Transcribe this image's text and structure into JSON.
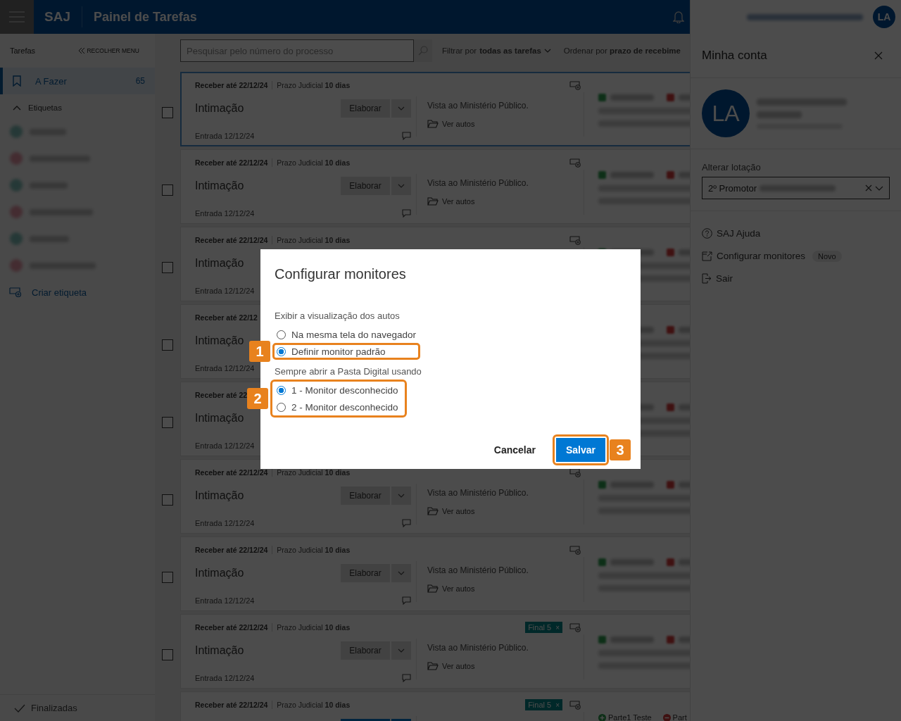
{
  "header": {
    "app": "SAJ",
    "title": "Painel de Tarefas"
  },
  "sidebar": {
    "title": "Tarefas",
    "collapse": "RECOLHER MENU",
    "items": [
      {
        "label": "A Fazer",
        "count": "65",
        "selected": true
      }
    ],
    "tags_section": {
      "label": "Etiquetas",
      "expanded": true
    },
    "create_tag": "Criar etiqueta",
    "finished": "Finalizadas"
  },
  "toolbar": {
    "search": {
      "placeholder": "Pesquisar pelo número do processo"
    },
    "filter": "Filtrar por **todas as tarefas**",
    "order": "Ordenar por **prazo de recebime**"
  },
  "cards": [
    {
      "selected": true,
      "checked": false,
      "receber": "Receber até 22/12/24",
      "prazo": "Prazo Judicial **10 dias**",
      "title": "Intimação",
      "button": {
        "label": "Elaborar",
        "kind": "secondary"
      },
      "vista": "Vista ao Ministério Público.",
      "link": "Ver autos",
      "entrada": "Entrada 12/12/24",
      "monitor_icon": true,
      "comment_icon": true,
      "parties_blurred": true
    },
    {
      "selected": false,
      "checked": false,
      "receber": "Receber até 22/12/24",
      "prazo": "Prazo Judicial **10 dias**",
      "title": "Intimação",
      "button": {
        "label": "Elaborar",
        "kind": "secondary"
      },
      "vista": "Vista ao Ministério Público.",
      "link": "Ver autos",
      "entrada": "Entrada 12/12/24",
      "monitor_icon": true,
      "comment_icon": true,
      "parties_blurred": true
    },
    {
      "selected": false,
      "checked": false,
      "receber": "Receber até 22/12/24",
      "prazo": "Prazo Judicial **10 dias**",
      "title": "Intimação",
      "entrada": "Entrada 12/12/24",
      "monitor_icon": true,
      "comment_icon": false,
      "parties_blurred": true
    },
    {
      "selected": false,
      "checked": false,
      "receber": "Receber até 22/12",
      "title": "Intimação",
      "entrada": "Entrada 12/12/24",
      "monitor_icon": false,
      "comment_icon": false,
      "parties_blurred": true
    },
    {
      "selected": false,
      "checked": false,
      "receber": "Receber até 22",
      "title": "Intimação",
      "entrada": "Entrada 12/12/24",
      "monitor_icon": false,
      "comment_icon": false,
      "parties_blurred": true
    },
    {
      "selected": false,
      "checked": false,
      "receber": "Receber até 22/12/24",
      "prazo": "Prazo Judicial **10 dias**",
      "title": "Intimação",
      "button": {
        "label": "Elaborar",
        "kind": "secondary"
      },
      "vista": "Vista ao Ministério Público.",
      "link": "Ver autos",
      "entrada": "Entrada 12/12/24",
      "monitor_icon": true,
      "comment_icon": true,
      "parties_blurred": true
    },
    {
      "selected": false,
      "checked": false,
      "receber": "Receber até 22/12/24",
      "prazo": "Prazo Judicial **10 dias**",
      "title": "Intimação",
      "button": {
        "label": "Elaborar",
        "kind": "secondary"
      },
      "vista": "Vista ao Ministério Público.",
      "link": "Ver autos",
      "entrada": "Entrada 12/12/24",
      "monitor_icon": true,
      "comment_icon": true,
      "parties_blurred": true
    },
    {
      "selected": false,
      "checked": false,
      "receber": "Receber até 22/12/24",
      "prazo": "Prazo Judicial **10 dias**",
      "title": "Intimação",
      "button": {
        "label": "Elaborar",
        "kind": "secondary"
      },
      "vista": "Vista ao Ministério Público.",
      "link": "Ver autos",
      "entrada": "Entrada 12/12/24",
      "tags": [
        {
          "label": "Final 5",
          "close": "×"
        }
      ],
      "monitor_icon": true,
      "comment_icon": true,
      "parties_blurred": true
    },
    {
      "selected": false,
      "receber": "Receber até 22/12/24",
      "prazo": "Prazo Judicial **10 dias**",
      "button": {
        "kind": "primary"
      },
      "tags": [
        {
          "label": "Final 5",
          "close": "×"
        }
      ],
      "monitor_icon": true,
      "comment_icon": false,
      "parties": [
        {
          "name": "Parte1 Teste",
          "kind": "active"
        },
        {
          "name": "Part",
          "kind": "passive"
        }
      ]
    }
  ],
  "account_panel": {
    "avatar": "LA",
    "title": "Minha conta",
    "profile_avatar": "LA",
    "location_label": "Alterar lotação",
    "location_value": "2º Promotor",
    "menu": [
      {
        "label": "SAJ Ajuda",
        "kind": "help"
      },
      {
        "label": "Configurar monitores",
        "kind": "monitors",
        "badge": "Novo"
      },
      {
        "label": "Sair",
        "kind": "logout"
      }
    ]
  },
  "dialog": {
    "title": "Configurar monitores",
    "groups": [
      {
        "label": "Exibir a visualização dos autos",
        "options": [
          {
            "label": "Na mesma tela do navegador",
            "selected": false
          },
          {
            "label": "Definir monitor padrão",
            "selected": true,
            "callout": "1"
          }
        ]
      },
      {
        "label": "Sempre abrir a Pasta Digital usando",
        "callout": "2",
        "options": [
          {
            "label": "1 - Monitor desconhecido",
            "selected": true
          },
          {
            "label": "2 - Monitor desconhecido",
            "selected": false
          }
        ]
      }
    ],
    "cancel": "Cancelar",
    "save": {
      "label": "Salvar",
      "callout": "3"
    }
  }
}
